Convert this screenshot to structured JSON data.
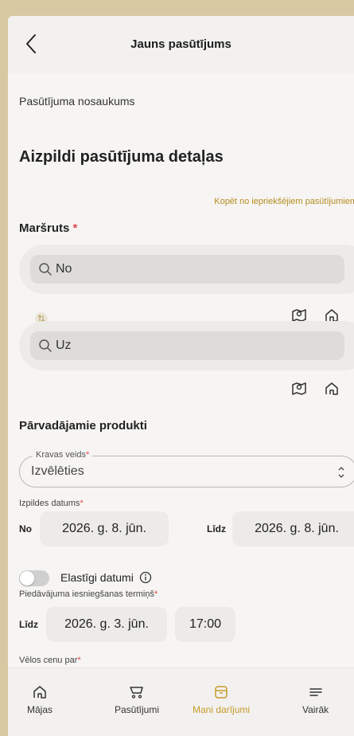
{
  "header": {
    "title": "Jauns pasūtījums"
  },
  "form": {
    "order_name_label": "Pasūtījuma nosaukums",
    "section_heading": "Aizpildi pasūtījuma detaļas",
    "copy_link": "Kopēt no iepriekšējiem pasūtījumiem",
    "route": {
      "label": "Maršruts",
      "required_mark": "*",
      "from_placeholder": "No",
      "to_placeholder": "Uz"
    },
    "products": {
      "label": "Pārvadājamie produkti",
      "cargo_type_legend": "Kravas veids",
      "required_mark": "*",
      "cargo_type_value": "Izvēlēties"
    },
    "execution_date": {
      "label": "Izpildes datums",
      "required_mark": "*",
      "from_label": "No",
      "from_value": "2026. g. 8. jūn.",
      "to_label": "Līdz",
      "to_value": "2026. g. 8. jūn."
    },
    "flexible_dates": {
      "label": "Elastīgi datumi",
      "enabled": false
    },
    "offer_deadline": {
      "label": "Piedāvājuma iesniegšanas termiņš",
      "required_mark": "*",
      "to_label": "Līdz",
      "date_value": "2026. g. 3. jūn.",
      "time_value": "17:00"
    },
    "price_for": {
      "label": "Vēlos cenu par",
      "required_mark": "*"
    }
  },
  "bottom_nav": {
    "items": [
      {
        "label": "Mājas",
        "icon": "home-icon"
      },
      {
        "label": "Pasūtījumi",
        "icon": "cart-icon"
      },
      {
        "label": "Mani darījumi",
        "icon": "box-icon",
        "active": true
      },
      {
        "label": "Vairāk",
        "icon": "menu-icon"
      }
    ]
  },
  "colors": {
    "accent": "#c79a2c",
    "required": "#e04a4a",
    "background": "#d8c9a3",
    "screen": "#f6f5f3"
  }
}
